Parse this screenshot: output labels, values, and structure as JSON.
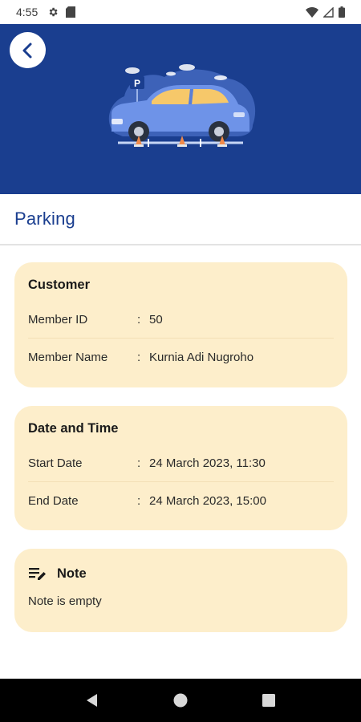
{
  "status_bar": {
    "time": "4:55",
    "icons": [
      "gear-icon",
      "sd-card-icon",
      "wifi-icon",
      "signal-icon",
      "battery-icon"
    ]
  },
  "header": {
    "back_icon": "chevron-left-icon",
    "illustration": "car-parking-illustration",
    "parking_sign": "P",
    "color": "#1a3e8f"
  },
  "page": {
    "title": "Parking"
  },
  "customer_card": {
    "title": "Customer",
    "rows": [
      {
        "label": "Member ID",
        "separator": ":",
        "value": "50"
      },
      {
        "label": "Member Name",
        "separator": ":",
        "value": "Kurnia Adi Nugroho"
      }
    ]
  },
  "datetime_card": {
    "title": "Date and Time",
    "rows": [
      {
        "label": "Start Date",
        "separator": ":",
        "value": "24 March 2023, 11:30"
      },
      {
        "label": "End Date",
        "separator": ":",
        "value": "24 March 2023, 15:00"
      }
    ]
  },
  "note_card": {
    "icon": "edit-note-icon",
    "title": "Note",
    "text": "Note is empty"
  },
  "nav_bar": {
    "buttons": [
      "back-triangle-icon",
      "home-circle-icon",
      "recents-square-icon"
    ]
  },
  "colors": {
    "primary": "#1a3e8f",
    "card_bg": "#fdeecb"
  }
}
